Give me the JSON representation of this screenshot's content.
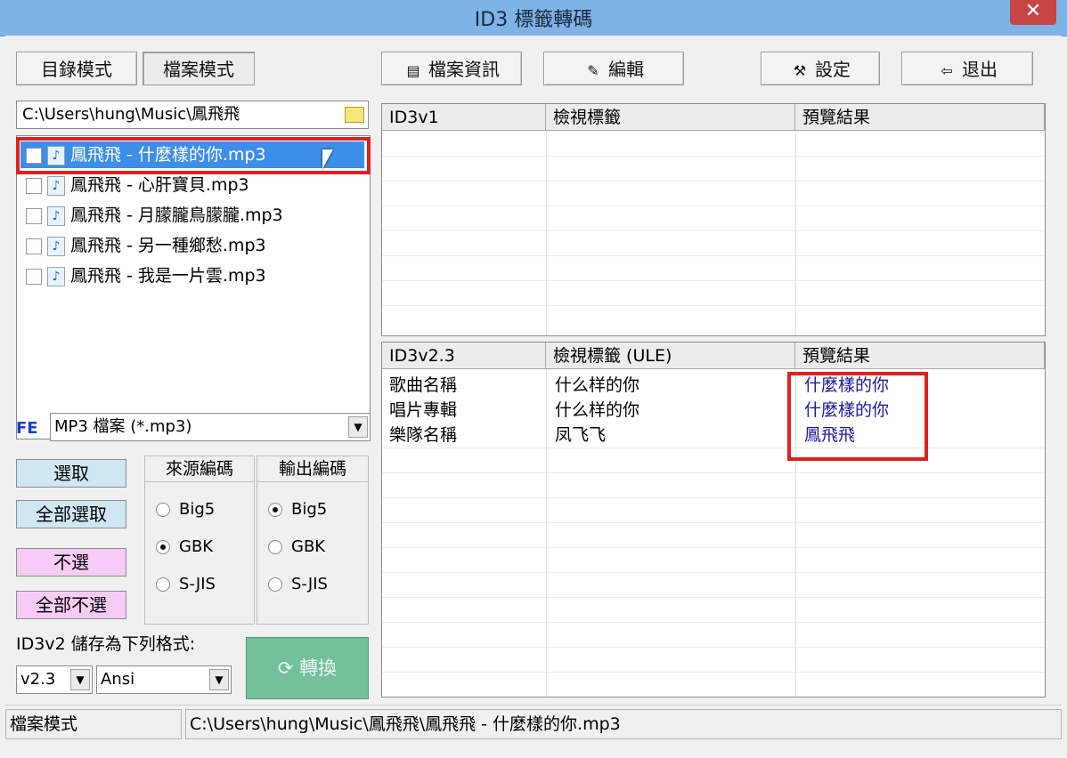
{
  "window": {
    "title": "ID3 標籤轉碼",
    "close_glyph": "✕"
  },
  "mode_buttons": {
    "dir_mode": "目錄模式",
    "file_mode": "檔案模式"
  },
  "toolbar": {
    "file_info": "檔案資訊",
    "edit": "編輯",
    "settings": "設定",
    "exit": "退出"
  },
  "path": "C:\\Users\\hung\\Music\\鳳飛飛",
  "files": [
    {
      "name": "鳳飛飛 - 什麼樣的你.mp3",
      "checked": false,
      "selected": true
    },
    {
      "name": "鳳飛飛 - 心肝寶貝.mp3",
      "checked": false,
      "selected": false
    },
    {
      "name": "鳳飛飛 - 月朦朧鳥朦朧.mp3",
      "checked": false,
      "selected": false
    },
    {
      "name": "鳳飛飛 - 另一種鄉愁.mp3",
      "checked": false,
      "selected": false
    },
    {
      "name": "鳳飛飛 - 我是一片雲.mp3",
      "checked": false,
      "selected": false
    }
  ],
  "filter": {
    "label": "FE",
    "value": "MP3 檔案 (*.mp3)"
  },
  "selection_buttons": {
    "select": "選取",
    "select_all": "全部選取",
    "deselect": "不選",
    "deselect_all": "全部不選"
  },
  "source_encoding": {
    "title": "來源編碼",
    "options": [
      "Big5",
      "GBK",
      "S-JIS"
    ],
    "selected": "GBK"
  },
  "output_encoding": {
    "title": "輸出編碼",
    "options": [
      "Big5",
      "GBK",
      "S-JIS"
    ],
    "selected": "Big5"
  },
  "save_format": {
    "label": "ID3v2 儲存為下列格式:",
    "version": "v2.3",
    "charset": "Ansi"
  },
  "convert_button": "轉換",
  "id3v1_table": {
    "headers": [
      "ID3v1",
      "檢視標籤",
      "預覽結果"
    ]
  },
  "id3v2_table": {
    "headers": [
      "ID3v2.3",
      "檢視標籤 (ULE)",
      "預覽結果"
    ],
    "rows": [
      [
        "歌曲名稱",
        "什么样的你",
        "什麼樣的你"
      ],
      [
        "唱片專輯",
        "什么样的你",
        "什麼樣的你"
      ],
      [
        "樂隊名稱",
        "凤飞飞",
        "鳳飛飛"
      ]
    ]
  },
  "status": {
    "mode": "檔案模式",
    "path": "C:\\Users\\hung\\Music\\鳳飛飛\\鳳飛飛 - 什麼樣的你.mp3"
  },
  "colors": {
    "highlight": "#3d8ee8",
    "preview_text": "#1a1aa8",
    "annotation_red": "#e02020",
    "convert_green": "#73c09a"
  }
}
